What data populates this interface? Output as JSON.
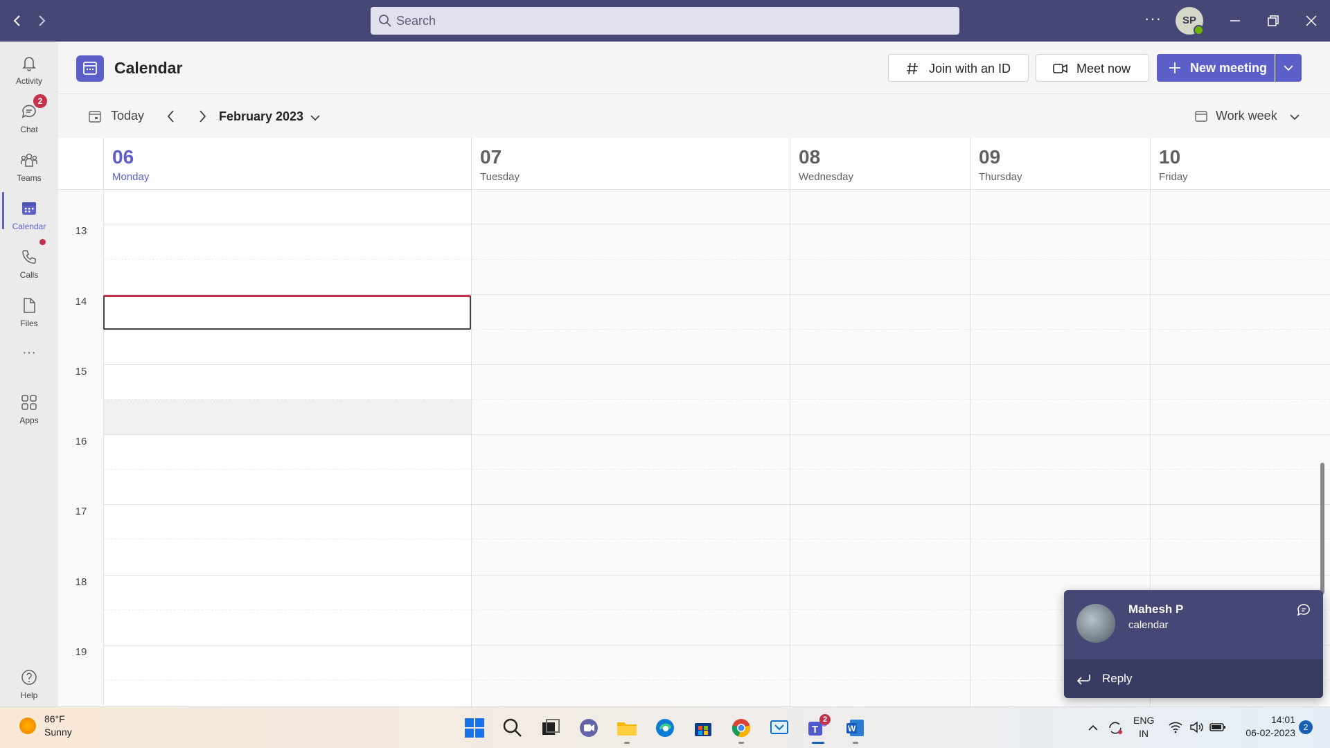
{
  "titlebar": {
    "search_placeholder": "Search",
    "more_label": "···",
    "avatar_initials": "SP"
  },
  "rail": {
    "items": [
      {
        "label": "Activity",
        "icon": "bell-icon"
      },
      {
        "label": "Chat",
        "icon": "chat-icon",
        "badge": "2"
      },
      {
        "label": "Teams",
        "icon": "teams-icon"
      },
      {
        "label": "Calendar",
        "icon": "calendar-icon",
        "active": true
      },
      {
        "label": "Calls",
        "icon": "phone-icon"
      },
      {
        "label": "Files",
        "icon": "file-icon"
      },
      {
        "label": "Apps",
        "icon": "apps-icon"
      },
      {
        "label": "Help",
        "icon": "help-icon"
      }
    ],
    "more_label": "···"
  },
  "header": {
    "title": "Calendar",
    "join_label": "Join with an ID",
    "meet_label": "Meet now",
    "new_meeting_label": "New meeting"
  },
  "toolbar": {
    "today_label": "Today",
    "month_label": "February 2023",
    "view_label": "Work week"
  },
  "days": [
    {
      "num": "06",
      "name": "Monday",
      "today": true
    },
    {
      "num": "07",
      "name": "Tuesday"
    },
    {
      "num": "08",
      "name": "Wednesday"
    },
    {
      "num": "09",
      "name": "Thursday"
    },
    {
      "num": "10",
      "name": "Friday"
    }
  ],
  "hours": [
    "13",
    "14",
    "15",
    "16",
    "17",
    "18",
    "19"
  ],
  "toast": {
    "sender": "Mahesh P",
    "message": "calendar",
    "reply_label": "Reply"
  },
  "taskbar": {
    "weather_temp": "86°F",
    "weather_desc": "Sunny",
    "lang_line1": "ENG",
    "lang_line2": "IN",
    "time": "14:01",
    "date": "06-02-2023",
    "notification_count": "2",
    "teams_badge": "2"
  },
  "colors": {
    "brand": "#5b5fc7",
    "titlebar": "#464775",
    "badge_red": "#c4314b"
  }
}
